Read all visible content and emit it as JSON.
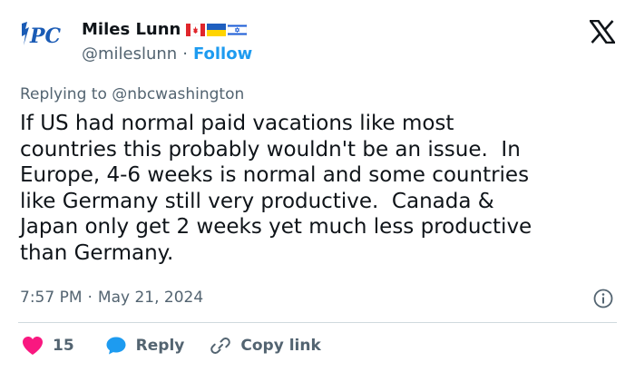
{
  "author": {
    "display_name": "Miles Lunn",
    "handle": "@mileslunn",
    "follow_label": "Follow",
    "separator": "·",
    "avatar_text": "PC",
    "flags": [
      "canada-flag",
      "ukraine-flag",
      "israel-flag"
    ]
  },
  "reply_context": {
    "prefix": "Replying to",
    "mention": "@nbcwashington"
  },
  "tweet": {
    "text": "If US had normal paid vacations like most\ncountries this probably wouldn't be an issue.  In\nEurope, 4-6 weeks is normal and some countries\nlike Germany still very productive.  Canada &\nJapan only get 2 weeks yet much less productive\nthan Germany.",
    "time": "7:57 PM",
    "separator": "·",
    "date": "May 21, 2024"
  },
  "actions": {
    "like_count": "15",
    "reply_label": "Reply",
    "copy_link_label": "Copy link"
  },
  "colors": {
    "accent": "#1d9bf0",
    "like": "#f91880",
    "text": "#0f1419",
    "muted": "#536471",
    "avatar_blue": "#1a5bb5"
  }
}
